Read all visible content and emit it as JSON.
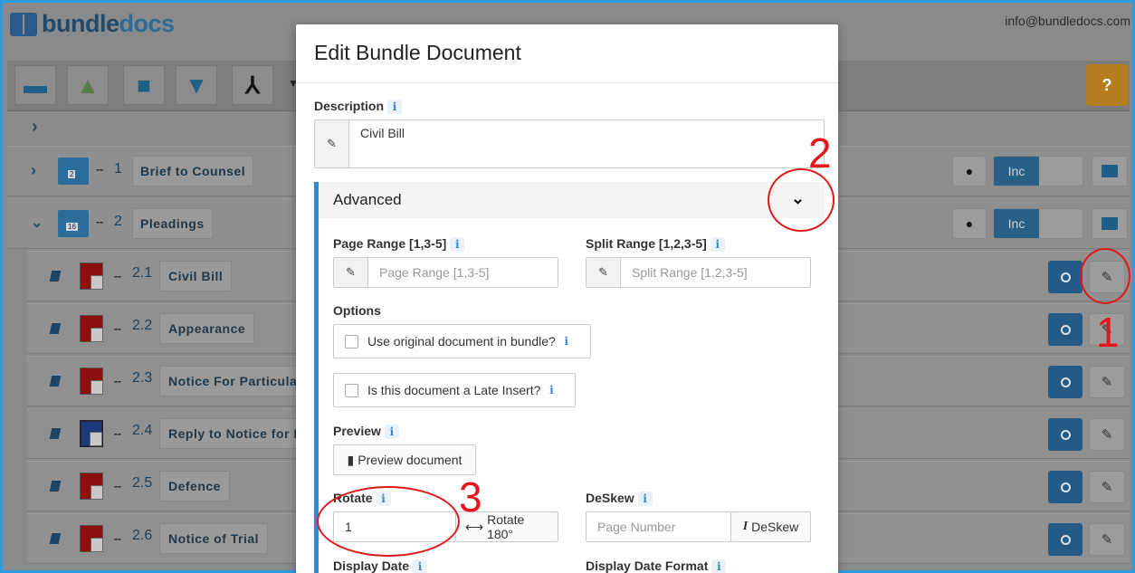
{
  "app": {
    "logo_main": "bundle",
    "logo_accent": "docs",
    "email": "info@bundledocs.com"
  },
  "toolbar": {
    "help_label": "?"
  },
  "sections": [
    {
      "index": "1",
      "title": "Brief to Counsel",
      "folder_count": "2",
      "inc_label": "Inc"
    },
    {
      "index": "2",
      "title": "Pleadings",
      "folder_count": "16",
      "inc_label": "Inc"
    }
  ],
  "documents": [
    {
      "index": "2.1",
      "title": "Civil Bill",
      "type": "pdf"
    },
    {
      "index": "2.2",
      "title": "Appearance",
      "type": "pdf"
    },
    {
      "index": "2.3",
      "title": "Notice For Particular",
      "type": "pdf"
    },
    {
      "index": "2.4",
      "title": "Reply to Notice for P",
      "type": "word"
    },
    {
      "index": "2.5",
      "title": "Defence",
      "type": "pdf"
    },
    {
      "index": "2.6",
      "title": "Notice of Trial",
      "type": "pdf"
    }
  ],
  "modal": {
    "title": "Edit Bundle Document",
    "description_label": "Description",
    "description_value": "Civil Bill",
    "advanced_label": "Advanced",
    "page_range_label": "Page Range [1,3-5]",
    "page_range_placeholder": "Page Range [1,3-5]",
    "split_range_label": "Split Range [1,2,3-5]",
    "split_range_placeholder": "Split Range [1,2,3-5]",
    "options_label": "Options",
    "use_original_label": "Use original document in bundle?",
    "late_insert_label": "Is this document a Late Insert?",
    "preview_label": "Preview",
    "preview_button": "Preview document",
    "rotate_label": "Rotate",
    "rotate_value": "1",
    "rotate_button": "Rotate 180°",
    "deskew_label": "DeSkew",
    "deskew_placeholder": "Page Number",
    "deskew_button": "DeSkew",
    "display_date_label": "Display Date",
    "display_date_format_label": "Display Date Format"
  },
  "annotations": {
    "one": "1",
    "two": "2",
    "three": "3",
    "color": "#e8141b"
  }
}
